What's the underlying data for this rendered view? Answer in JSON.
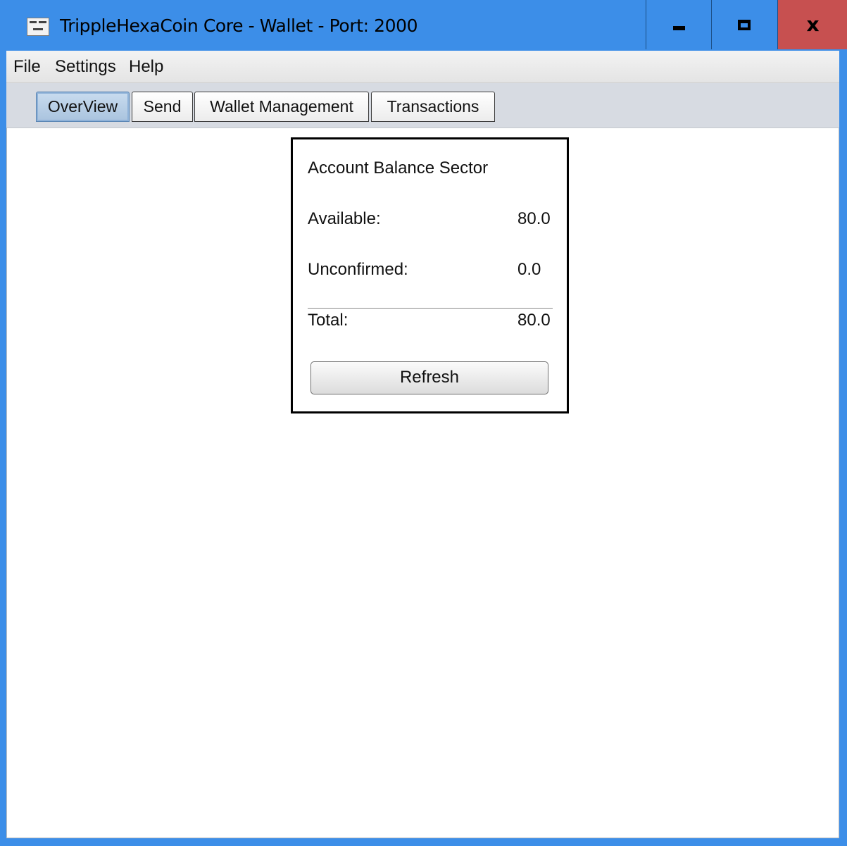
{
  "window": {
    "title": "TrippleHexaCoin Core - Wallet - Port: 2000",
    "controls": {
      "minimize": "minimize",
      "maximize": "maximize",
      "close": "x"
    }
  },
  "menubar": {
    "items": [
      "File",
      "Settings",
      "Help"
    ]
  },
  "tabs": {
    "items": [
      "OverView",
      "Send",
      "Wallet Management",
      "Transactions"
    ],
    "selected": "OverView"
  },
  "balance_panel": {
    "title": "Account Balance Sector",
    "available_label": "Available:",
    "available_value": "80.0",
    "unconfirmed_label": "Unconfirmed:",
    "unconfirmed_value": "0.0",
    "total_label": "Total:",
    "total_value": "80.0",
    "refresh_label": "Refresh"
  },
  "colors": {
    "titlebar": "#3c8ee8",
    "close_button": "#c75050",
    "tab_selected": "#b8cfe7"
  },
  "icons": {
    "app": "app-icon",
    "minimize": "minimize-icon",
    "maximize": "maximize-icon",
    "close": "close-icon"
  }
}
